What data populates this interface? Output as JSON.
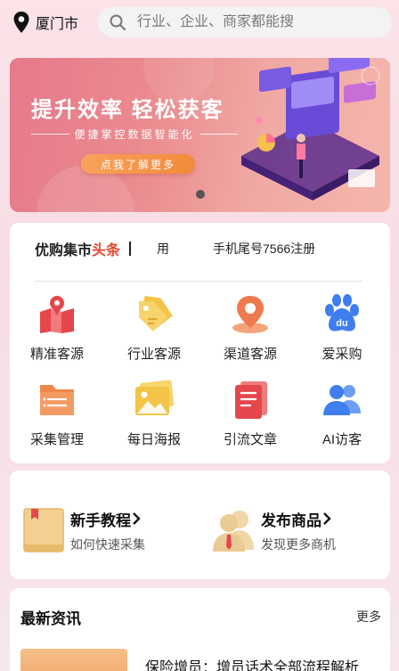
{
  "header": {
    "city": "厦门市",
    "search_placeholder": "行业、企业、商家都能搜"
  },
  "banner": {
    "title": "提升效率 轻松获客",
    "subtitle": "便捷掌控数据智能化",
    "cta": "点我了解更多"
  },
  "headline": {
    "brand_main": "优购集市",
    "brand_accent": "头条",
    "ticker_left": "用",
    "ticker": "手机尾号7566注册"
  },
  "grid": [
    {
      "label": "精准客源",
      "icon": "map-icon"
    },
    {
      "label": "行业客源",
      "icon": "tag-icon"
    },
    {
      "label": "渠道客源",
      "icon": "location-icon"
    },
    {
      "label": "爱采购",
      "icon": "baidu-paw-icon"
    },
    {
      "label": "采集管理",
      "icon": "folder-list-icon"
    },
    {
      "label": "每日海报",
      "icon": "picture-icon"
    },
    {
      "label": "引流文章",
      "icon": "document-icon"
    },
    {
      "label": "AI访客",
      "icon": "users-icon"
    }
  ],
  "guide": {
    "tutorial_title": "新手教程",
    "tutorial_sub": "如何快速采集",
    "publish_title": "发布商品",
    "publish_sub": "发现更多商机"
  },
  "news": {
    "header": "最新资讯",
    "more": "更多",
    "first_title": "保险增员：增员话术全部流程解析"
  },
  "colors": {
    "accent_red": "#e8452c",
    "cta_orange": "#f48a3a",
    "icon_blue": "#3f7ef0",
    "icon_yellow": "#f3c445"
  }
}
